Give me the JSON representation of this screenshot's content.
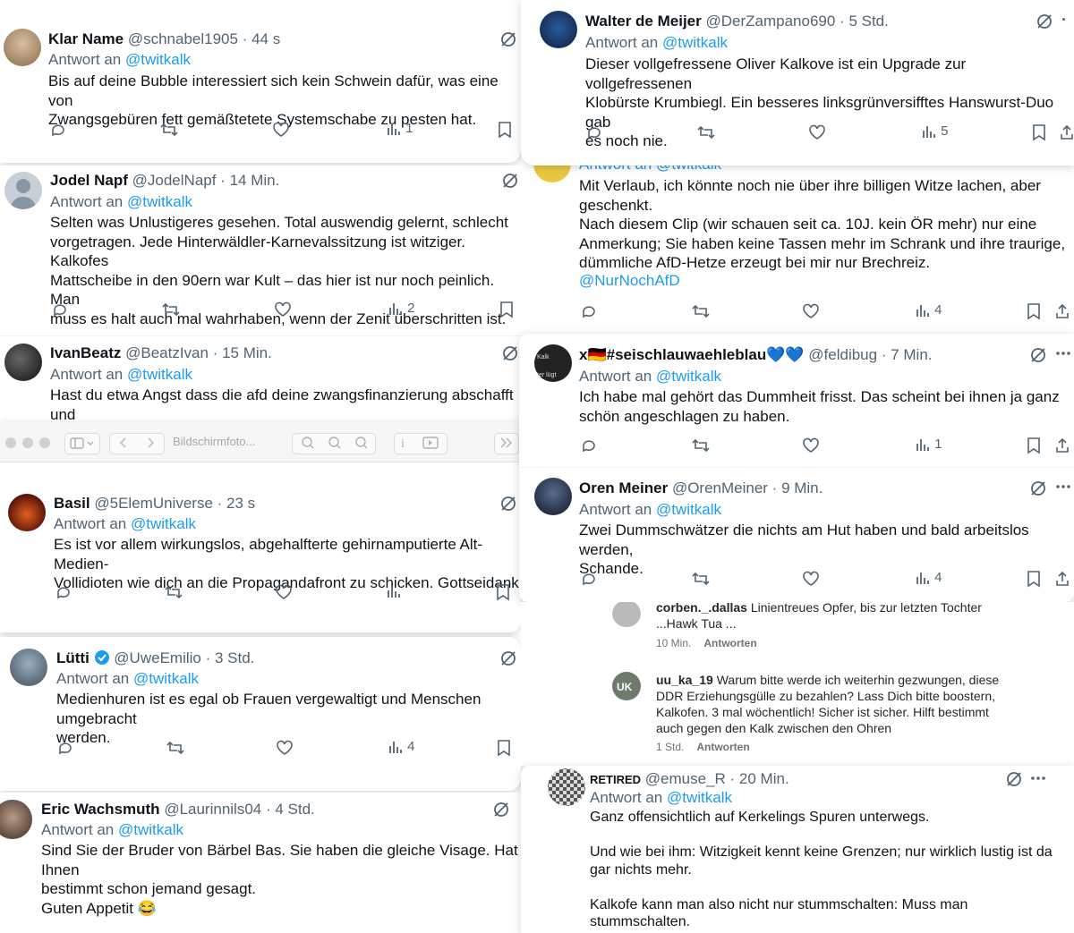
{
  "tweets_left": [
    {
      "name": "Klar Name",
      "handle": "@schnabel1905",
      "time": "44 s",
      "reply_prefix": "Antwort an",
      "reply_to": "@twitkalk",
      "text": "Bis auf deine Bubble interessiert sich kein Schwein dafür, was eine von\nZwangsgebüren fett gemäßtetete Systemschabe zu pesten hat.",
      "views": "1"
    },
    {
      "name": "Jodel Napf",
      "handle": "@JodelNapf",
      "time": "14 Min.",
      "reply_prefix": "Antwort an",
      "reply_to": "@twitkalk",
      "text": "Selten was Unlustigeres gesehen. Total auswendig gelernt, schlecht\nvorgetragen. Jede Hinterwäldler-Karnevalssitzung ist witziger. Kalkofes\nMattscheibe in den 90ern war Kult – das hier ist nur noch peinlich. Man\nmuss es halt auch mal wahrhaben, wenn der Zenit überschritten ist.",
      "views": "2"
    },
    {
      "name": "IvanBeatz",
      "handle": "@BeatzIvan",
      "time": "15 Min.",
      "reply_prefix": "Antwort an",
      "reply_to": "@twitkalk",
      "text": "Hast du etwa Angst dass die afd deine zwangsfinanzierung abschafft und\ndu bald in der freien Wirtschaft einen neuen Job suchen musst?",
      "views": ""
    },
    {
      "name": "Basil",
      "handle": "@5ElemUniverse",
      "time": "23 s",
      "reply_prefix": "Antwort an",
      "reply_to": "@twitkalk",
      "text": "Es ist vor allem wirkungslos, abgehalfterte gehirnamputierte Alt-Medien-\nVollidioten wie dich an die Propagandafront zu schicken. Gottseidank.",
      "views": ""
    },
    {
      "name": "Lütti",
      "handle": "@UweEmilio",
      "time": "3 Std.",
      "reply_prefix": "Antwort an",
      "reply_to": "@twitkalk",
      "text": "Medienhuren ist es egal ob Frauen  vergewaltigt und Menschen umgebracht\nwerden.",
      "views": "4"
    },
    {
      "name": "Eric Wachsmuth",
      "handle": "@Laurinnils04",
      "time": "4 Std.",
      "reply_prefix": "Antwort an",
      "reply_to": "@twitkalk",
      "text": "Sind Sie der Bruder von Bärbel Bas. Sie haben die gleiche Visage. Hat Ihnen\nbestimmt schon jemand gesagt.\nGuten Appetit 😂",
      "views": ""
    }
  ],
  "tweets_right": [
    {
      "name": "Walter de Meijer",
      "handle": "@DerZampano690",
      "time": "5 Std.",
      "reply_prefix": "Antwort an",
      "reply_to": "@twitkalk",
      "text": "Dieser vollgefressene Oliver Kalkove ist ein Upgrade zur vollgefressenen\nKlobürste Krumbiegl. Ein besseres linksgrünversifftes Hanswurst-Duo gab\nes noch nie.",
      "views": "5"
    },
    {
      "partial_reply": "Antwort an @twitkalk",
      "text": "Mit Verlaub, ich könnte noch nie über ihre billigen Witze lachen, aber\ngeschenkt.\nNach diesem Clip (wir schauen seit ca. 10J. kein ÖR mehr) nur eine\nAnmerkung; Sie haben keine Tassen mehr im Schrank und ihre traurige,\ndümmliche AfD-Hetze erzeugt bei mir nur Brechreiz.",
      "link": "@NurNochAfD",
      "views": "4"
    },
    {
      "name": "x🇩🇪#seischlauwaehleblau💙💙",
      "handle": "@feldibug",
      "time": "7 Min.",
      "reply_prefix": "Antwort an",
      "reply_to": "@twitkalk",
      "text": "Ich habe mal gehört das Dummheit frisst. Das scheint bei ihnen ja ganz\nschön angeschlagen zu haben.",
      "views": "1"
    },
    {
      "name": "Oren Meiner",
      "handle": "@OrenMeiner",
      "time": "9 Min.",
      "reply_prefix": "Antwort an",
      "reply_to": "@twitkalk",
      "text": "Zwei Dummschwätzer die nichts am Hut haben und bald arbeitslos werden,\nSchande.",
      "views": "4"
    },
    {
      "name": "RETIRED",
      "handle": "@emuse_R",
      "time": "20 Min.",
      "reply_prefix": "Antwort an",
      "reply_to": "@twitkalk",
      "text": "Ganz offensichtlich auf Kerkelings Spuren unterwegs.\n\nUnd wie bei ihm: Witzigkeit kennt keine Grenzen; nur wirklich lustig ist da\ngar nichts mehr.\n\nKalkofe kann man also nicht nur stummschalten: Muss man\nstummschalten.",
      "views": ""
    }
  ],
  "preview_window": {
    "title": "Bildschirmfoto..."
  },
  "instagram_comments": [
    {
      "user": "corben._.dallas",
      "text": "Linientreues Opfer, bis zur letzten Tochter\n...Hawk Tua ...",
      "time": "10 Min.",
      "reply": "Antworten"
    },
    {
      "user": "uu_ka_19",
      "text": "Warum bitte werde ich weiterhin gezwungen, diese\nDDR Erziehungsgülle zu bezahlen? Lass Dich bitte boostern,\nKalkofen. 3 mal wöchentlich! Sicher ist sicher. Hilft bestimmt\nauch gegen den Kalk zwischen den Ohren",
      "time": "1 Std.",
      "reply": "Antworten"
    }
  ],
  "colors": {
    "link": "#1d9bf0",
    "text": "#0f1419",
    "muted": "#536471",
    "verified": "#1d9bf0"
  }
}
